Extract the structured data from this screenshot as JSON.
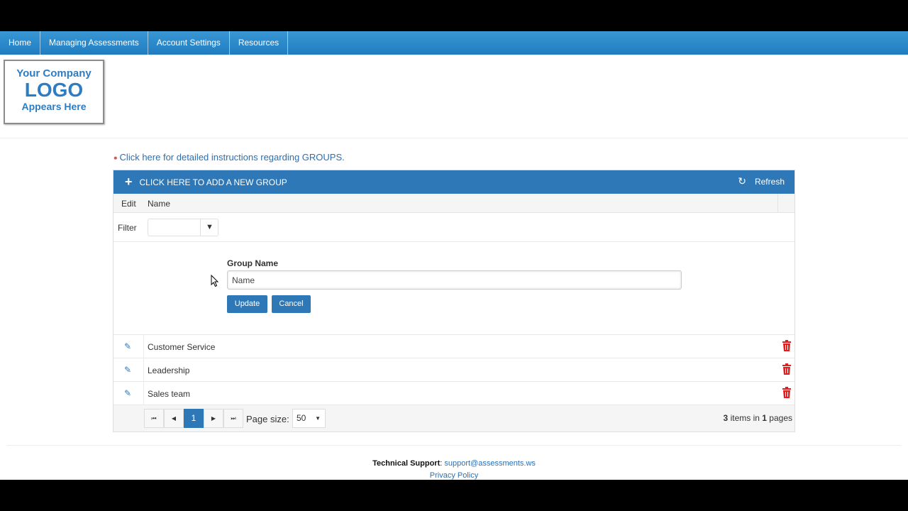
{
  "nav": {
    "items": [
      {
        "label": "Home"
      },
      {
        "label": "Managing Assessments"
      },
      {
        "label": "Account Settings"
      },
      {
        "label": "Resources"
      }
    ]
  },
  "logo": {
    "line1": "Your Company",
    "line2": "LOGO",
    "line3": "Appears Here"
  },
  "instructions_link": "Click here for detailed instructions regarding GROUPS.",
  "toolbar": {
    "add_label": "CLICK HERE TO ADD A NEW GROUP",
    "refresh_label": "Refresh"
  },
  "columns": {
    "edit": "Edit",
    "name": "Name"
  },
  "filter": {
    "label": "Filter"
  },
  "edit_form": {
    "label": "Group Name",
    "value": "Name",
    "update_label": "Update",
    "cancel_label": "Cancel"
  },
  "rows": [
    {
      "name": "Customer Service"
    },
    {
      "name": "Leadership"
    },
    {
      "name": "Sales team"
    }
  ],
  "pager": {
    "current_page": "1",
    "page_size_label": "Page size:",
    "page_size": "50",
    "item_count": "3",
    "items_in_text": "items in",
    "page_count": "1",
    "pages_text": "pages"
  },
  "footer": {
    "support_label": "Technical Support",
    "support_email": "support@assessments.ws",
    "privacy": "Privacy Policy"
  },
  "colors": {
    "primary": "#2f78b8",
    "danger": "#e02020",
    "link": "#2a6fb6"
  },
  "icons": {
    "add": "plus-icon",
    "refresh": "refresh-icon",
    "filter": "filter-icon",
    "edit": "pencil-icon",
    "delete": "trash-icon"
  }
}
